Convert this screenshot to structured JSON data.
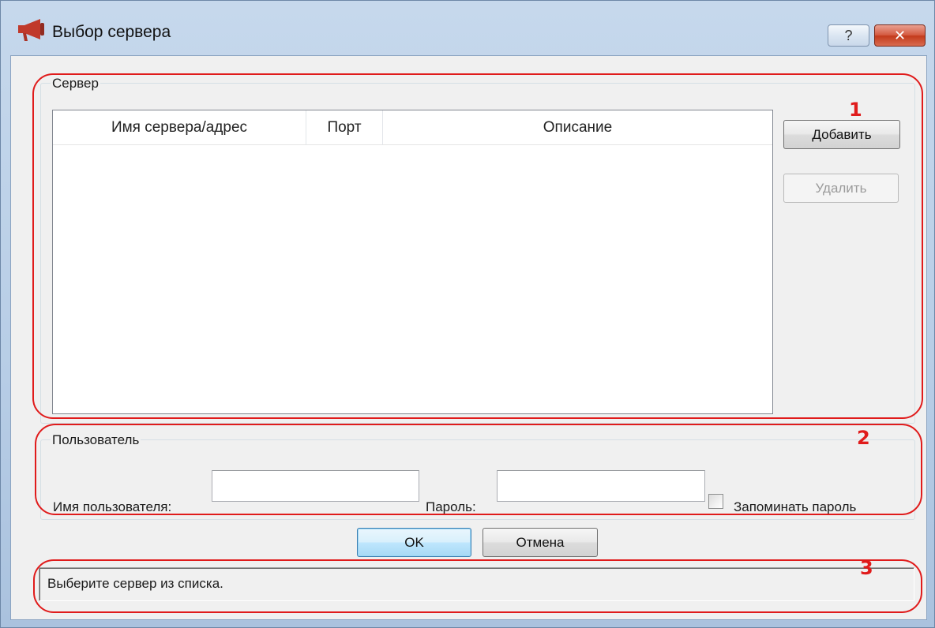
{
  "window": {
    "title": "Выбор сервера",
    "help_glyph": "?",
    "close_glyph": "✕"
  },
  "server_group": {
    "label": "Сервер",
    "columns": [
      "Имя сервера/адрес",
      "Порт",
      "Описание"
    ],
    "rows": [],
    "add_button": "Добавить",
    "remove_button": "Удалить"
  },
  "user_group": {
    "label": "Пользователь",
    "username_label": "Имя пользователя:",
    "username_value": "",
    "password_label": "Пароль:",
    "password_value": "",
    "remember_label": "Запоминать пароль",
    "remember_checked": false
  },
  "buttons": {
    "ok": "OK",
    "cancel": "Отмена"
  },
  "status": {
    "text": "Выберите сервер из списка."
  },
  "annotations": [
    "1",
    "2",
    "3"
  ],
  "colors": {
    "annotation": "#e01b1b",
    "close_button": "#c33a1c",
    "default_button_border": "#3c7fb1"
  },
  "icons": {
    "app": "megaphone-icon"
  }
}
